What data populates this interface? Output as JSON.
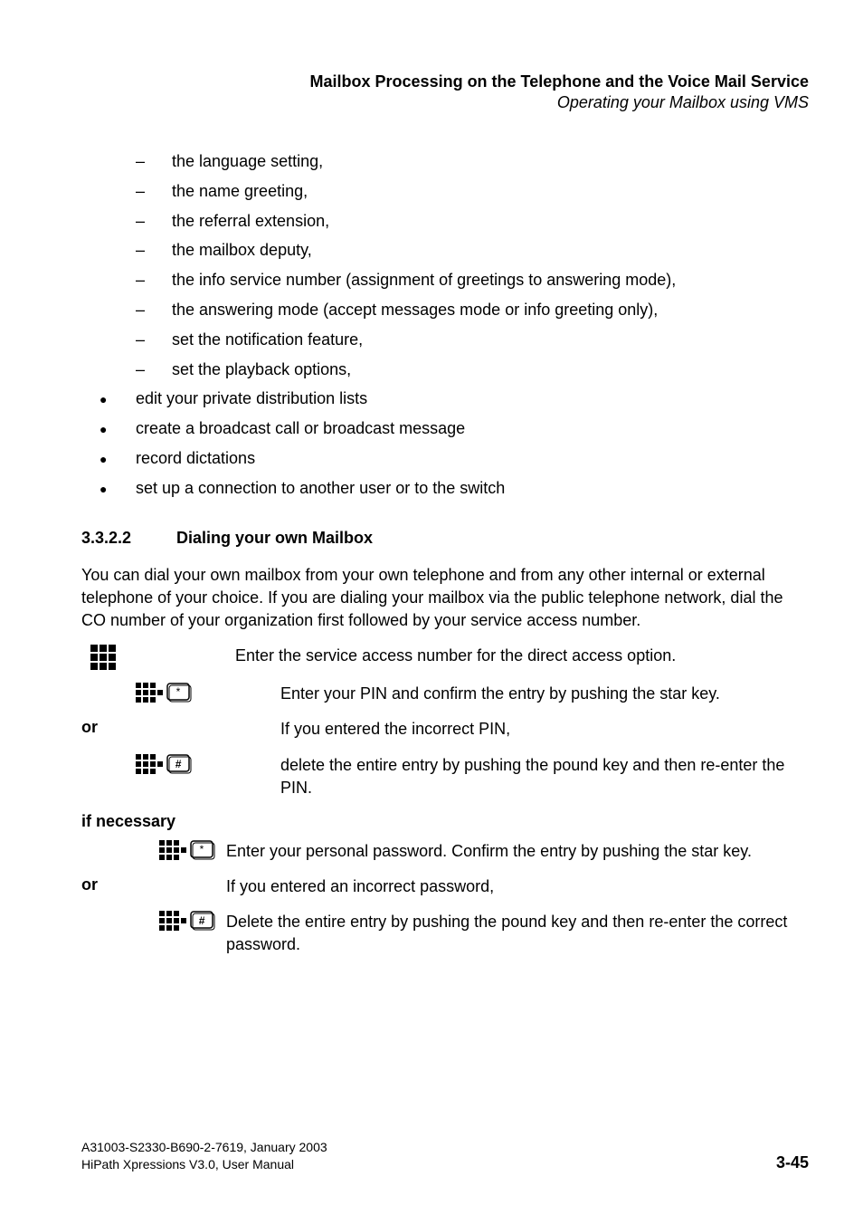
{
  "header": {
    "title": "Mailbox Processing on the Telephone and the Voice Mail Service",
    "subtitle": "Operating your Mailbox using VMS"
  },
  "sublist": [
    "the language setting,",
    "the name greeting,",
    "the referral extension,",
    "the mailbox deputy,",
    "the info service number (assignment of greetings to answering mode),",
    "the answering mode (accept messages mode or info greeting only),",
    "set the notification feature,",
    "set the playback options,"
  ],
  "mainlist": [
    "edit your private distribution lists",
    "create a broadcast call or broadcast message",
    "record dictations",
    "set up a connection to another user or to the switch"
  ],
  "section": {
    "number": "3.3.2.2",
    "title": "Dialing your own Mailbox"
  },
  "intro": "You can dial your own mailbox from your own telephone and from any other internal or external telephone of your choice. If you are dialing your mailbox via the public telephone network, dial the CO number of your organization first followed by your service access number.",
  "steps": {
    "s1": "Enter the service access number for the direct access option.",
    "s2": "Enter your PIN and confirm the entry by pushing the star key.",
    "or1": "or",
    "s3a": "If you entered the incorrect PIN,",
    "s3b": "delete the entire entry by pushing the pound key and then re-enter the PIN.",
    "ifnec": "if necessary",
    "s4": "Enter your personal password. Confirm the entry by pushing the star key.",
    "or2": "or",
    "s5a": "If you entered an incorrect password,",
    "s5b": "Delete the entire entry by pushing the pound key and then re-enter the correct password."
  },
  "footer": {
    "line1": "A31003-S2330-B690-2-7619, January 2003",
    "line2": "HiPath Xpressions V3.0, User Manual",
    "page": "3-45"
  }
}
